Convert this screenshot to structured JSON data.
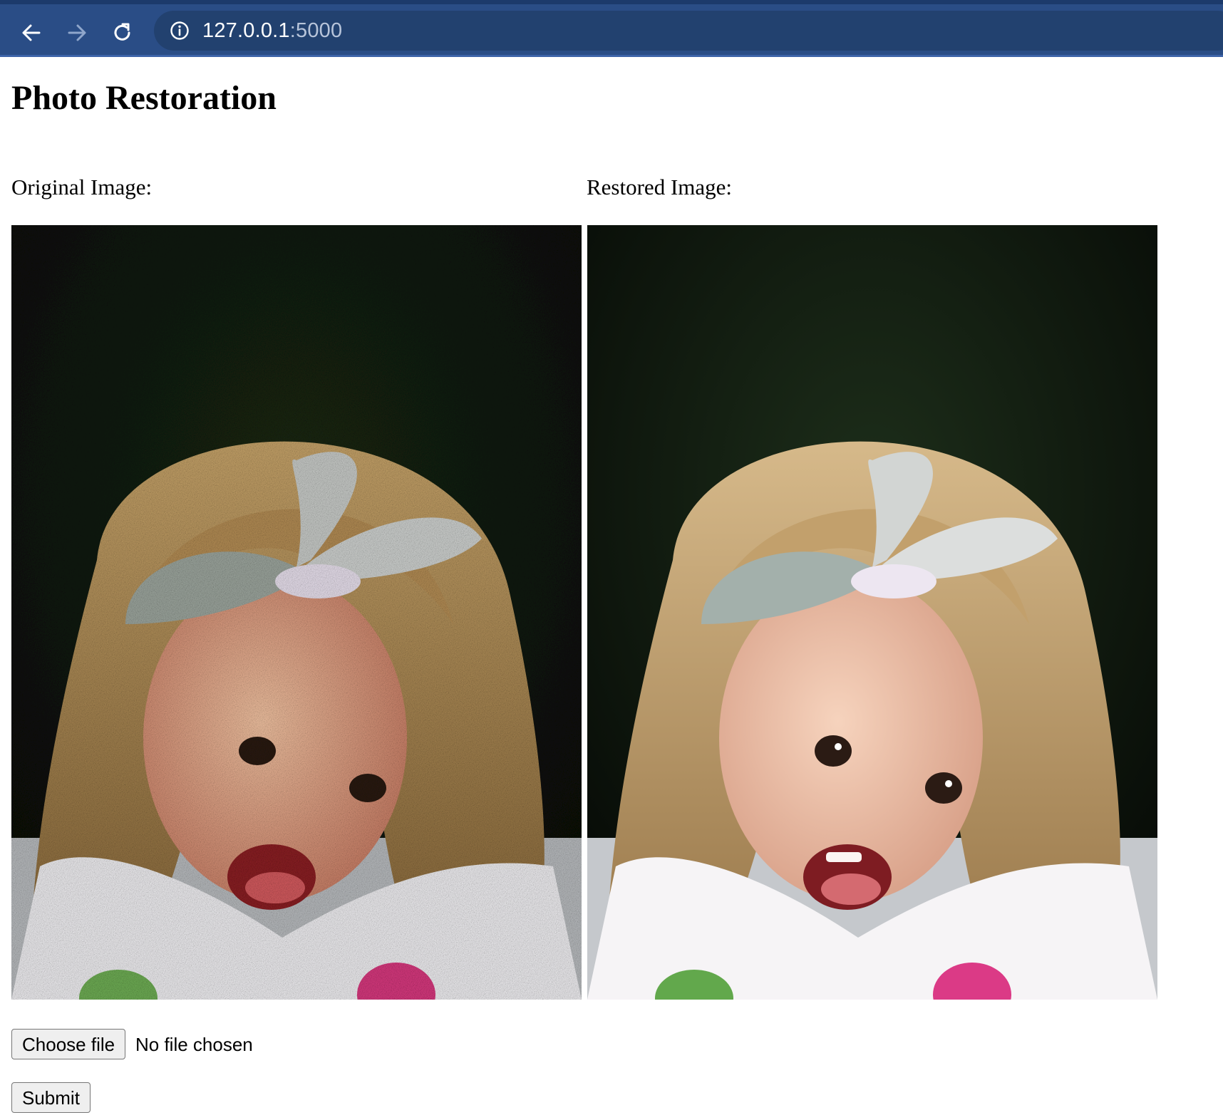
{
  "browser": {
    "url_host": "127.0.0.1",
    "url_port": ":5000",
    "icons": [
      "back-arrow-icon",
      "forward-arrow-icon",
      "reload-icon",
      "site-info-icon"
    ]
  },
  "page": {
    "title": "Photo Restoration",
    "original_label": "Original Image:",
    "restored_label": "Restored Image:"
  },
  "images": {
    "original_alt": "Original Image",
    "restored_alt": "Restored Image"
  },
  "form": {
    "choose_file_label": "Choose file",
    "file_status": "No file chosen",
    "submit_label": "Submit"
  },
  "colors": {
    "chrome_bg": "#2a4d86",
    "address_bg": "#22416f"
  }
}
